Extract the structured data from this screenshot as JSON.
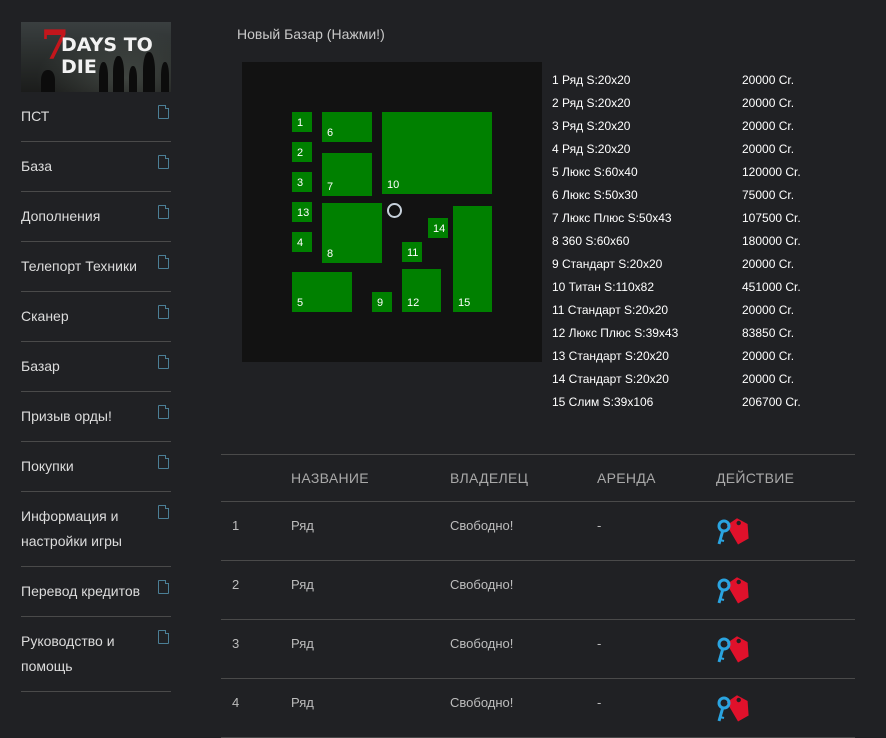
{
  "sidebar": {
    "logo_text": "7DAYS TO DIE",
    "items": [
      {
        "label": "ПСТ",
        "icon": "document-icon"
      },
      {
        "label": "База",
        "icon": "document-icon"
      },
      {
        "label": "Дополнения",
        "icon": "document-icon"
      },
      {
        "label": "Телепорт Техники",
        "icon": "document-icon"
      },
      {
        "label": "Сканер",
        "icon": "document-icon"
      },
      {
        "label": "Базар",
        "icon": "document-icon"
      },
      {
        "label": "Призыв орды!",
        "icon": "document-icon"
      },
      {
        "label": "Покупки",
        "icon": "document-icon"
      },
      {
        "label": "Информация и настройки игры",
        "icon": "document-icon"
      },
      {
        "label": "Перевод кредитов",
        "icon": "document-icon"
      },
      {
        "label": "Руководство и помощь",
        "icon": "document-icon"
      }
    ]
  },
  "main": {
    "title": "Новый Базар (Нажми!)",
    "map": {
      "lot_color": "#008000",
      "lots": [
        "1",
        "2",
        "3",
        "4",
        "5",
        "6",
        "7",
        "8",
        "9",
        "10",
        "11",
        "12",
        "13",
        "14",
        "15"
      ]
    },
    "price_list": [
      {
        "name": "1 Ряд S:20x20",
        "price": "20000 Cr."
      },
      {
        "name": "2 Ряд S:20x20",
        "price": "20000 Cr."
      },
      {
        "name": "3 Ряд S:20x20",
        "price": "20000 Cr."
      },
      {
        "name": "4 Ряд S:20x20",
        "price": "20000 Cr."
      },
      {
        "name": "5 Люкс S:60x40",
        "price": "120000 Cr."
      },
      {
        "name": "6 Люкс S:50x30",
        "price": "75000 Cr."
      },
      {
        "name": "7 Люкс Плюс S:50x43",
        "price": "107500 Cr."
      },
      {
        "name": "8 360 S:60x60",
        "price": "180000 Cr."
      },
      {
        "name": "9 Стандарт S:20x20",
        "price": "20000 Cr."
      },
      {
        "name": "10 Титан S:110x82",
        "price": "451000 Cr."
      },
      {
        "name": "11 Стандарт S:20x20",
        "price": "20000 Cr."
      },
      {
        "name": "12 Люкс Плюс S:39x43",
        "price": "83850 Cr."
      },
      {
        "name": "13 Стандарт S:20x20",
        "price": "20000 Cr."
      },
      {
        "name": "14 Стандарт S:20x20",
        "price": "20000 Cr."
      },
      {
        "name": "15 Слим S:39x106",
        "price": "206700 Cr."
      }
    ],
    "table": {
      "headers": {
        "name": "НАЗВАНИЕ",
        "owner": "ВЛАДЕЛЕЦ",
        "rent": "АРЕНДА",
        "action": "ДЕЙСТВИЕ"
      },
      "rows": [
        {
          "num": "1",
          "name": "Ряд",
          "owner": "Свободно!",
          "rent": "-",
          "action_icon": "key-tag-icon"
        },
        {
          "num": "2",
          "name": "Ряд",
          "owner": "Свободно!",
          "rent": "",
          "action_icon": "key-tag-icon"
        },
        {
          "num": "3",
          "name": "Ряд",
          "owner": "Свободно!",
          "rent": "-",
          "action_icon": "key-tag-icon"
        },
        {
          "num": "4",
          "name": "Ряд",
          "owner": "Свободно!",
          "rent": "-",
          "action_icon": "key-tag-icon"
        }
      ]
    }
  }
}
